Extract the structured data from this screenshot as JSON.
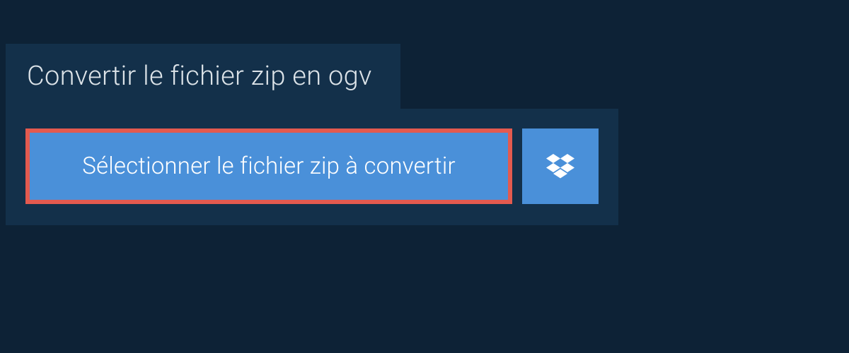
{
  "tab": {
    "title": "Convertir le fichier zip en ogv"
  },
  "actions": {
    "select_file_label": "Sélectionner le fichier zip à convertir"
  },
  "colors": {
    "background": "#0d2236",
    "panel": "#13304a",
    "button": "#4a90d9",
    "highlight_border": "#e35a4f",
    "text_light": "#dce3e8"
  }
}
